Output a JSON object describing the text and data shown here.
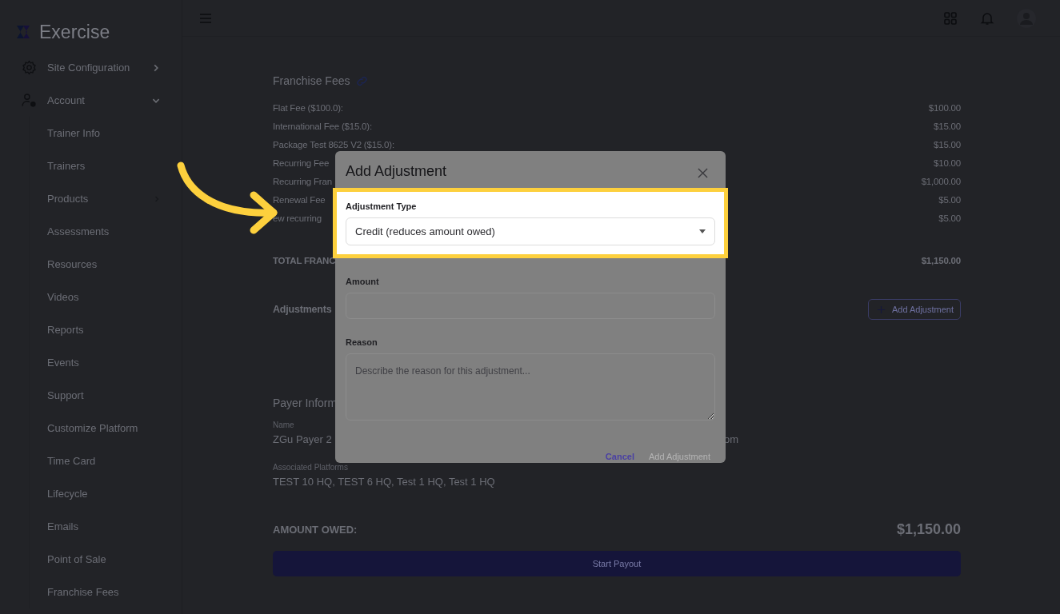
{
  "app": {
    "name": "Exercise"
  },
  "sidebar": {
    "items": [
      {
        "label": "Site Configuration",
        "expanded": false
      },
      {
        "label": "Account",
        "expanded": true,
        "children": [
          {
            "label": "Trainer Info",
            "kind": "link"
          },
          {
            "label": "Trainers",
            "kind": "link"
          },
          {
            "label": "Products",
            "kind": "submenu"
          },
          {
            "label": "Assessments",
            "kind": "link"
          },
          {
            "label": "Resources",
            "kind": "link"
          },
          {
            "label": "Videos",
            "kind": "link"
          },
          {
            "label": "Reports",
            "kind": "link"
          },
          {
            "label": "Events",
            "kind": "link"
          },
          {
            "label": "Support",
            "kind": "link"
          },
          {
            "label": "Customize Platform",
            "kind": "link"
          },
          {
            "label": "Time Card",
            "kind": "link"
          },
          {
            "label": "Lifecycle",
            "kind": "link"
          },
          {
            "label": "Emails",
            "kind": "link"
          },
          {
            "label": "Point of Sale",
            "kind": "link"
          },
          {
            "label": "Franchise Fees",
            "kind": "link"
          }
        ]
      }
    ]
  },
  "fees": {
    "title": "Franchise Fees",
    "rows": [
      {
        "label": "Flat Fee ($100.0):",
        "amount": "$100.00"
      },
      {
        "label": "International Fee ($15.0):",
        "amount": "$15.00"
      },
      {
        "label": "Package Test 8625 V2 ($15.0):",
        "amount": "$15.00"
      },
      {
        "label": "Recurring Fee",
        "amount": "$10.00"
      },
      {
        "label": "Recurring Fran",
        "amount": "$1,000.00"
      },
      {
        "label": "Renewal Fee",
        "amount": "$5.00"
      },
      {
        "label": "ew recurring",
        "amount": "$5.00"
      }
    ],
    "total": {
      "label": "TOTAL FRANC",
      "amount": "$1,150.00"
    }
  },
  "adjustments": {
    "title": "Adjustments",
    "add_button": "Add Adjustment"
  },
  "payer": {
    "title": "Payer Inform",
    "fields": [
      {
        "label": "Name",
        "value": "ZGu Payer 2"
      },
      {
        "value": "om"
      },
      {
        "label": "Associated Platforms",
        "value": "TEST 10 HQ, TEST 6 HQ, Test 1 HQ, Test 1 HQ"
      }
    ]
  },
  "amount_owed": {
    "label": "AMOUNT OWED:",
    "amount": "$1,150.00",
    "button": "Start Payout"
  },
  "modal": {
    "title": "Add Adjustment",
    "fields": [
      {
        "kind": "select",
        "label": "Adjustment Type",
        "value": "Credit (reduces amount owed)",
        "highlighted": true
      },
      {
        "kind": "input",
        "label": "Amount",
        "highlighted": false
      },
      {
        "kind": "textarea",
        "label": "Reason",
        "placeholder": "Describe the reason for this adjustment...",
        "highlighted": false
      }
    ],
    "buttons": [
      {
        "label": "Cancel",
        "kind": "link",
        "disabled": false
      },
      {
        "label": "Add Adjustment",
        "kind": "primary",
        "disabled": true
      }
    ]
  }
}
